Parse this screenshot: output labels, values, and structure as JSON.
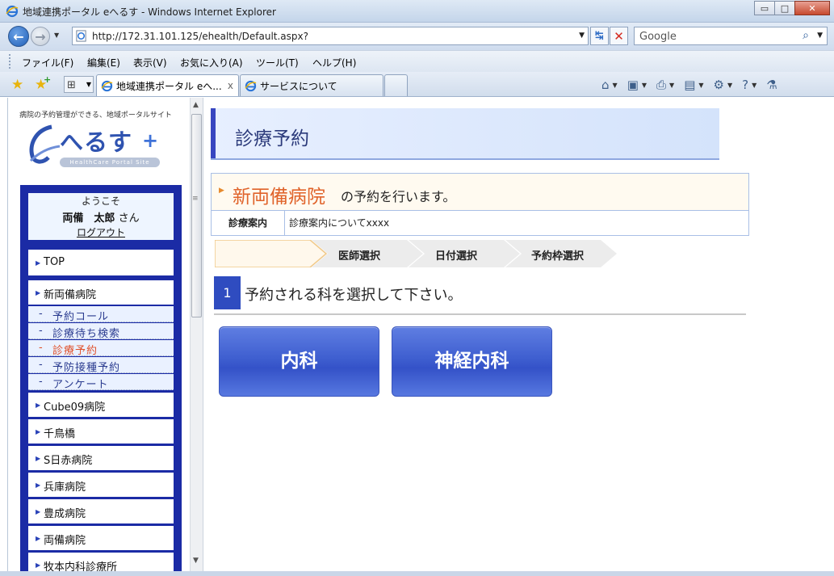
{
  "window": {
    "title": "地域連携ポータル eへるす - Windows Internet Explorer",
    "buttons": [
      "▭",
      "□",
      "✕"
    ]
  },
  "address_bar": {
    "url": "http://172.31.101.125/ehealth/Default.aspx?",
    "search_placeholder": "Google"
  },
  "menu": {
    "items": [
      "ファイル(F)",
      "編集(E)",
      "表示(V)",
      "お気に入り(A)",
      "ツール(T)",
      "ヘルプ(H)"
    ]
  },
  "tabs": {
    "active": "地域連携ポータル eへ...",
    "inactive": "サービスについて",
    "close_glyph": "x"
  },
  "sidebar": {
    "tagline": "病院の予約管理ができる、地域ポータルサイト",
    "logo_text": "へるす",
    "logo_sub": "HealthCare Portal Site",
    "welcome": {
      "greeting": "ようこそ",
      "user_name": "両備　太郎",
      "honorific": "さん",
      "logout": "ログアウト"
    },
    "top_link": "TOP",
    "current_hospital": "新両備病院",
    "sub_items": [
      "予約コール",
      "診療待ち検索",
      "診療予約",
      "予防接種予約",
      "アンケート"
    ],
    "current_sub_index": 2,
    "hospitals": [
      "Cube09病院",
      "千鳥橋",
      "S日赤病院",
      "兵庫病院",
      "豊成病院",
      "両備病院",
      "牧本内科診療所"
    ]
  },
  "main": {
    "page_title": "診療予約",
    "hospital_name": "新両備病院",
    "hospital_suffix": "の予約を行います。",
    "info_label": "診療案内",
    "info_value": "診療案内についてxxxx",
    "steps": [
      "",
      "医師選択",
      "日付選択",
      "予約枠選択"
    ],
    "current_step_index": 0,
    "instruction_number": "1",
    "instruction_text": "予約される科を選択して下さい。",
    "departments": [
      "内科",
      "神経内科"
    ]
  },
  "colors": {
    "nav_blue": "#1b2ba5",
    "accent_orange": "#e0632a",
    "button_blue": "#3f5fd0"
  }
}
